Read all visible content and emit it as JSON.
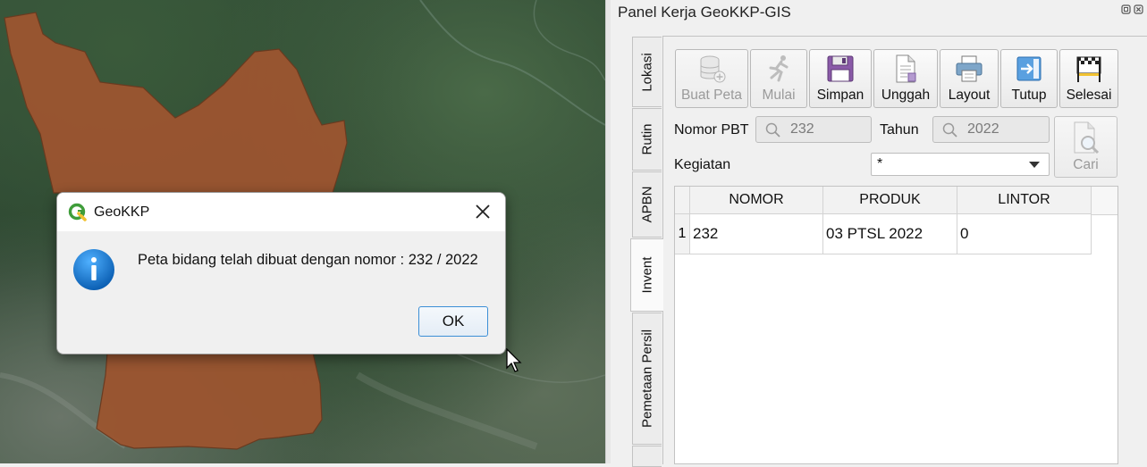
{
  "map": {
    "polygon_fill": "#9b5530",
    "polygon_stroke": "#6b3a1f"
  },
  "dialog": {
    "title": "GeoKKP",
    "message": "Peta bidang telah dibuat dengan nomor : 232 / 2022",
    "ok_label": "OK",
    "icon": "info-icon",
    "accent": "#1a7fd3"
  },
  "panel": {
    "title": "Panel Kerja GeoKKP-GIS",
    "tabs": [
      {
        "label": "Lokasi",
        "active": false
      },
      {
        "label": "Rutin",
        "active": false
      },
      {
        "label": "APBN",
        "active": false
      },
      {
        "label": "Invent",
        "active": true
      },
      {
        "label": "Pemetaan Persil",
        "active": false
      }
    ],
    "toolbar": [
      {
        "label": "Buat Peta",
        "icon": "database-add-icon",
        "enabled": false
      },
      {
        "label": "Mulai",
        "icon": "runner-icon",
        "enabled": false
      },
      {
        "label": "Simpan",
        "icon": "floppy-disk-icon",
        "enabled": true
      },
      {
        "label": "Unggah",
        "icon": "document-upload-icon",
        "enabled": true
      },
      {
        "label": "Layout",
        "icon": "printer-icon",
        "enabled": true
      },
      {
        "label": "Tutup",
        "icon": "exit-arrow-icon",
        "enabled": true
      },
      {
        "label": "Selesai",
        "icon": "finish-flag-icon",
        "enabled": true
      }
    ],
    "form": {
      "nomor_pbt_label": "Nomor PBT",
      "nomor_pbt_value": "232",
      "tahun_label": "Tahun",
      "tahun_value": "2022",
      "kegiatan_label": "Kegiatan",
      "kegiatan_value": "*",
      "cari_label": "Cari"
    },
    "table": {
      "columns": [
        "NOMOR",
        "PRODUK",
        "LINTOR"
      ],
      "rows": [
        {
          "index": "1",
          "cells": [
            "232",
            "03 PTSL 2022",
            "0"
          ]
        }
      ]
    }
  }
}
